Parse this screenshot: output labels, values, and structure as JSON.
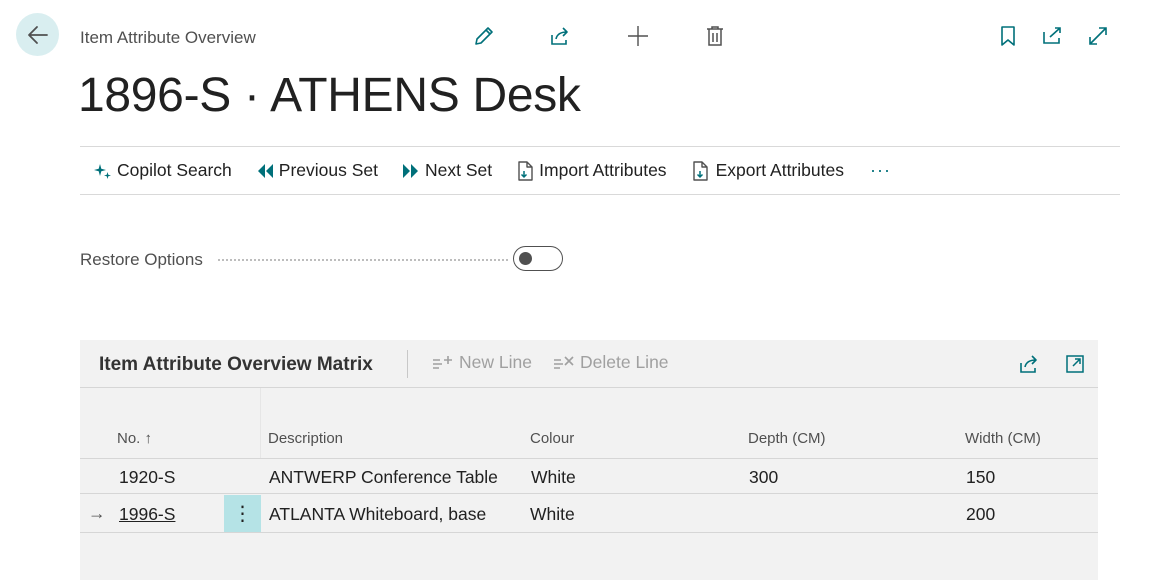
{
  "header": {
    "breadcrumb": "Item Attribute Overview",
    "title": "1896-S · ATHENS Desk"
  },
  "actions": {
    "copilot_search": "Copilot Search",
    "previous_set": "Previous Set",
    "next_set": "Next Set",
    "import_attributes": "Import Attributes",
    "export_attributes": "Export Attributes",
    "more": "···"
  },
  "restore": {
    "label": "Restore Options",
    "enabled": false
  },
  "matrix": {
    "title": "Item Attribute Overview Matrix",
    "new_line": "New Line",
    "delete_line": "Delete Line",
    "columns": {
      "no": "No.",
      "sort_indicator": "↑",
      "description": "Description",
      "colour": "Colour",
      "depth": "Depth (CM)",
      "width": "Width (CM)"
    },
    "rows": [
      {
        "no": "1920-S",
        "description": "ANTWERP Conference Table",
        "colour": "White",
        "depth": "300",
        "width": "150"
      },
      {
        "no": "1996-S",
        "description": "ATLANTA Whiteboard, base",
        "colour": "White",
        "depth": "",
        "width": "200",
        "current_row_marker": "→",
        "row_menu": "⋮"
      }
    ]
  },
  "colors": {
    "accent": "#00707a",
    "back_button_bg": "#d9eef0",
    "panel_bg": "#f2f2f2",
    "row_menu_bg": "#b5e3e6",
    "disabled_text": "#a0a0a0"
  },
  "icons": [
    "arrow-left-icon",
    "pencil-icon",
    "share-icon",
    "plus-icon",
    "trash-icon",
    "bookmark-icon",
    "open-new-window-icon",
    "expand-icon",
    "sparkle-icon",
    "previous-set-icon",
    "next-set-icon",
    "import-icon",
    "export-icon",
    "new-line-icon",
    "delete-line-icon",
    "share-icon",
    "focus-icon"
  ]
}
